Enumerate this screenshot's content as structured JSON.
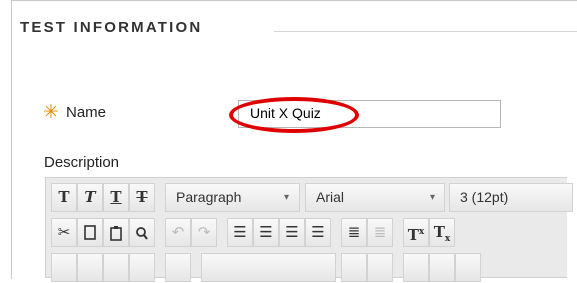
{
  "section": {
    "heading": "TEST INFORMATION"
  },
  "form": {
    "required_icon": "asterisk-icon",
    "name_label": "Name",
    "name_value": "Unit X Quiz",
    "description_label": "Description"
  },
  "annotation": {
    "color": "#e00000"
  },
  "toolbar": {
    "row1": {
      "bold_glyph": "T",
      "italic_glyph": "T",
      "underline_glyph": "T",
      "strike_glyph": "T",
      "format_value": "Paragraph",
      "font_value": "Arial",
      "size_value": "3 (12pt)"
    },
    "row2": {
      "icons": [
        "cut-icon",
        "copy-icon",
        "paste-icon",
        "find-icon",
        "undo-icon",
        "redo-icon",
        "align-left-icon",
        "align-center-icon",
        "align-right-icon",
        "justify-icon",
        "bullet-list-icon",
        "numbered-list-icon",
        "superscript-icon",
        "subscript-icon"
      ],
      "superscript_glyph": "T",
      "subscript_glyph": "T"
    }
  }
}
